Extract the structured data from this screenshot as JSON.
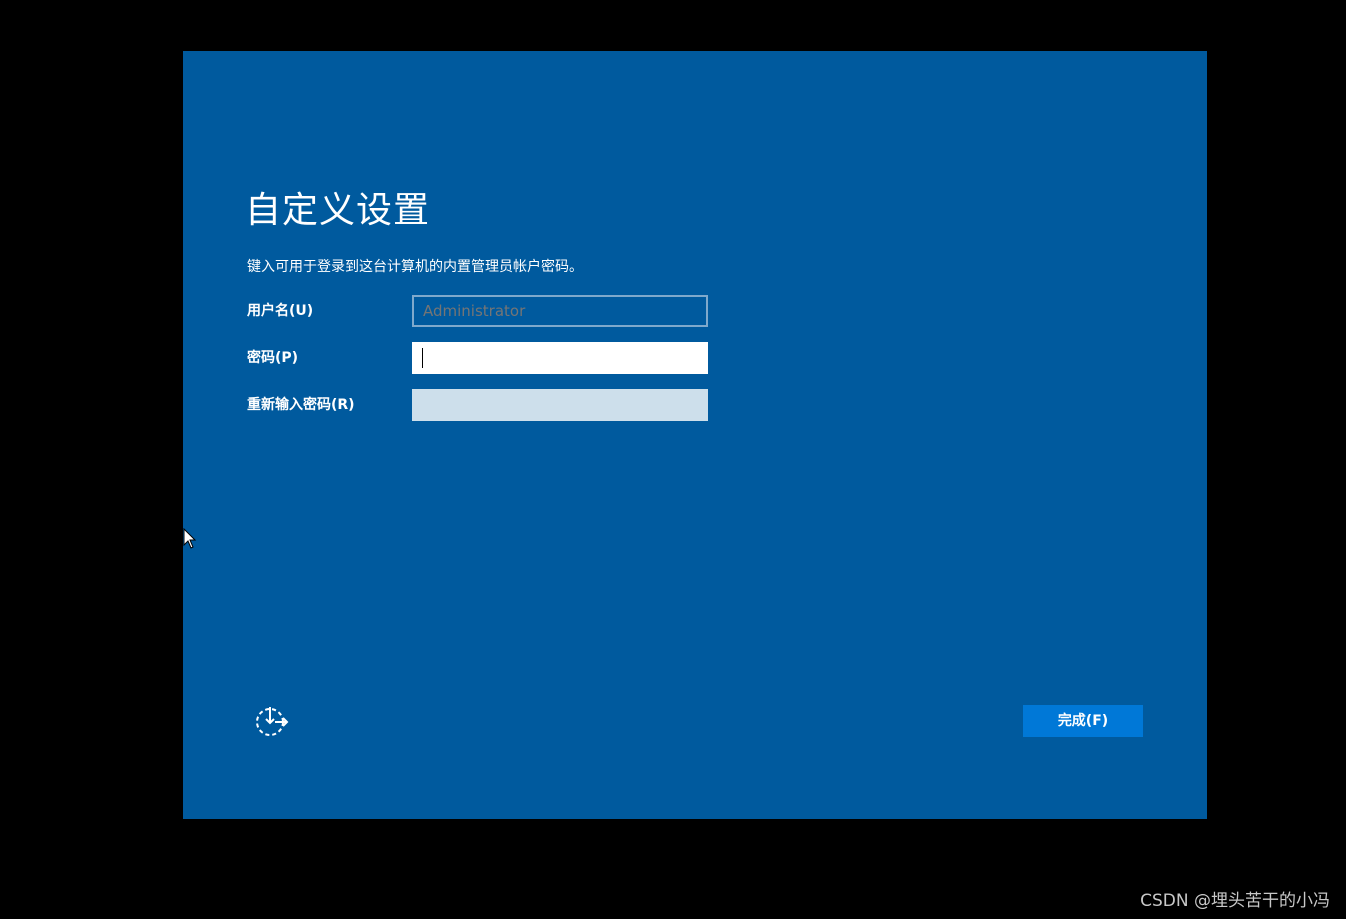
{
  "setup": {
    "title": "自定义设置",
    "instruction": "键入可用于登录到这台计算机的内置管理员帐户密码。",
    "fields": {
      "username": {
        "label": "用户名(U)",
        "placeholder": "Administrator",
        "value": ""
      },
      "password": {
        "label": "密码(P)",
        "value": ""
      },
      "confirm_password": {
        "label": "重新输入密码(R)",
        "value": ""
      }
    },
    "ease_of_access_icon": "ease-of-access-icon",
    "finish_label": "完成(F)"
  },
  "colors": {
    "background": "#000000",
    "panel": "#005a9e",
    "button": "#0078d7",
    "text": "#ffffff"
  },
  "watermark": "CSDN @埋头苦干的小冯"
}
